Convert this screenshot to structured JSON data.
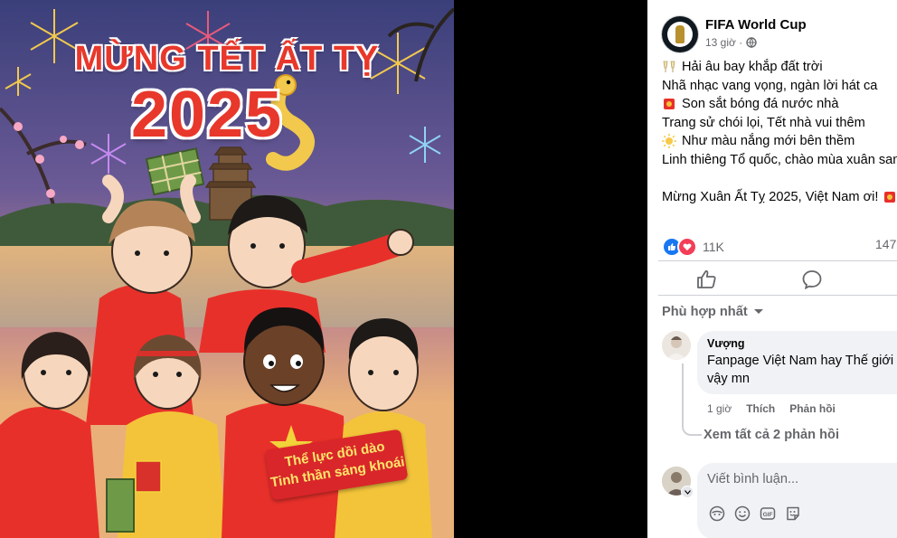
{
  "image": {
    "title_line1": "MỪNG TẾT ẤT TỴ",
    "title_line2": "2025",
    "banner_line1": "Thể lực dồi dào",
    "banner_line2": "Tinh thần sảng khoái"
  },
  "post": {
    "page_name": "FIFA World Cup",
    "time": "13 giờ ·",
    "audience_icon": "globe-icon",
    "lines": [
      {
        "emoji": "cheers-icon",
        "text": "Hải âu bay khắp đất trời"
      },
      {
        "emoji": "",
        "text": "Nhã nhạc vang vọng, ngàn lời hát ca"
      },
      {
        "emoji": "red-envelope-icon",
        "text": "Son sắt bóng đá nước nhà"
      },
      {
        "emoji": "",
        "text": "Trang sử chói lọi, Tết nhà vui thêm"
      },
      {
        "emoji": "sun-icon",
        "text": "Như màu nắng mới bên thềm"
      },
      {
        "emoji": "",
        "text": "Linh thiêng Tổ quốc, chào mùa xuân sang"
      },
      {
        "emoji": "",
        "text": ""
      },
      {
        "emoji": "",
        "text": "Mừng Xuân Ất Tỵ 2025, Việt Nam ơi!"
      }
    ],
    "reactions_count": "11K",
    "comments_count": "147"
  },
  "comments": {
    "sort_label": "Phù hợp nhất",
    "items": [
      {
        "author": "Vượng",
        "text": "Fanpage Việt Nam hay Thế giới vậy mn",
        "time": "1 giờ",
        "like_label": "Thích",
        "reply_label": "Phản hồi"
      }
    ],
    "view_replies": "Xem tất cả 2 phản hồi",
    "composer_placeholder": "Viết bình luận..."
  },
  "colors": {
    "accent_blue": "#1877f2",
    "love_red": "#f33e58",
    "title_red": "#e8382b"
  }
}
